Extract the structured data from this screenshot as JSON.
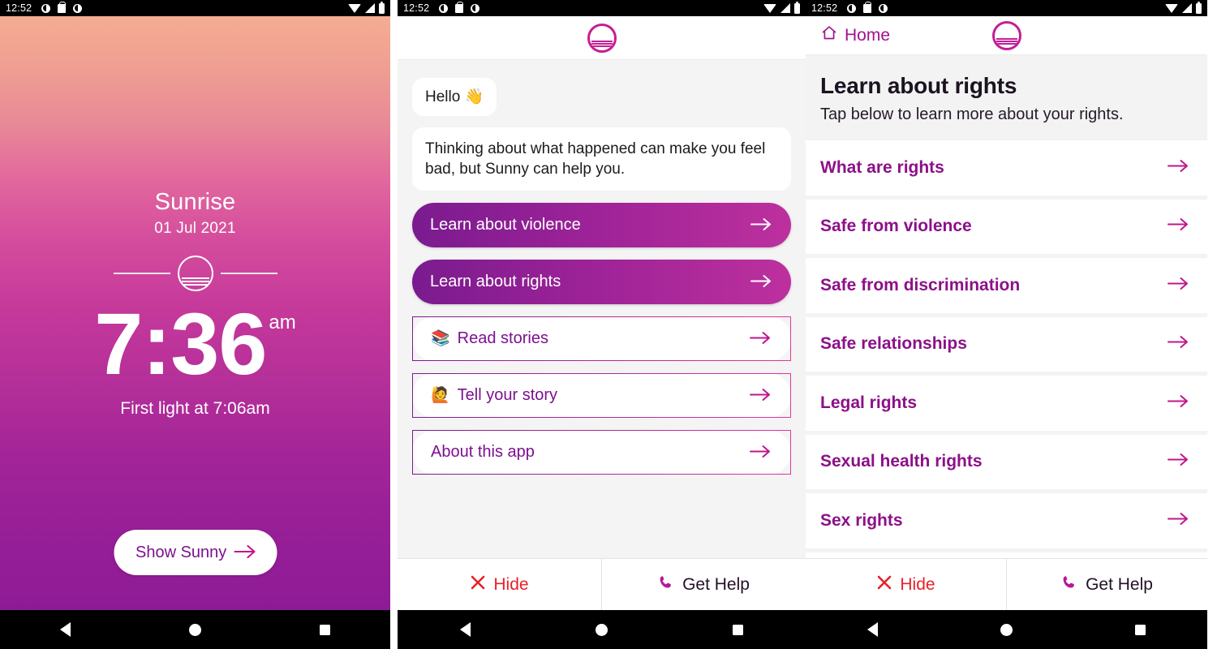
{
  "status_bar": {
    "time": "12:52",
    "left_icons": [
      "half-circle-icon",
      "bag-icon",
      "half-circle-icon"
    ],
    "right_icons": [
      "wifi-icon",
      "signal-icon",
      "battery-icon"
    ]
  },
  "nav_bar": {
    "back": "back-triangle-icon",
    "home": "home-circle-icon",
    "recents": "recents-square-icon"
  },
  "panel_sunrise": {
    "title": "Sunrise",
    "date": "01 Jul 2021",
    "time": "7:36",
    "meridiem": "am",
    "first_light": "First light at 7:06am",
    "cta_label": "Show Sunny",
    "gradient_top": "#f4ac92",
    "gradient_mid": "#c4389a",
    "gradient_bottom": "#8e1b96"
  },
  "panel_chat": {
    "logo": "sunrise-logo-icon",
    "messages": [
      {
        "text": "Hello 👋"
      },
      {
        "text": "Thinking about what happened can make you feel bad, but Sunny can help you."
      }
    ],
    "actions": [
      {
        "label": "Learn about violence",
        "style": "filled",
        "emoji": ""
      },
      {
        "label": "Learn about rights",
        "style": "filled",
        "emoji": ""
      },
      {
        "label": "Read stories",
        "style": "outline",
        "emoji": "📚"
      },
      {
        "label": "Tell your story",
        "style": "outline",
        "emoji": "🙋"
      },
      {
        "label": "About this app",
        "style": "outline",
        "emoji": ""
      }
    ],
    "footer": {
      "hide_label": "Hide",
      "help_label": "Get Help",
      "hide_color": "#e8202a",
      "help_color": "#231127"
    }
  },
  "panel_rights": {
    "home_label": "Home",
    "logo": "sunrise-logo-icon",
    "title": "Learn about rights",
    "subtitle": "Tap below to learn more about your rights.",
    "items": [
      {
        "label": "What are rights"
      },
      {
        "label": "Safe from violence"
      },
      {
        "label": "Safe from discrimination"
      },
      {
        "label": "Safe relationships"
      },
      {
        "label": "Legal rights"
      },
      {
        "label": "Sexual health rights"
      },
      {
        "label": "Sex rights"
      }
    ],
    "footer": {
      "hide_label": "Hide",
      "help_label": "Get Help"
    },
    "accent_color": "#8c1089",
    "arrow_color": "#c2168b"
  }
}
